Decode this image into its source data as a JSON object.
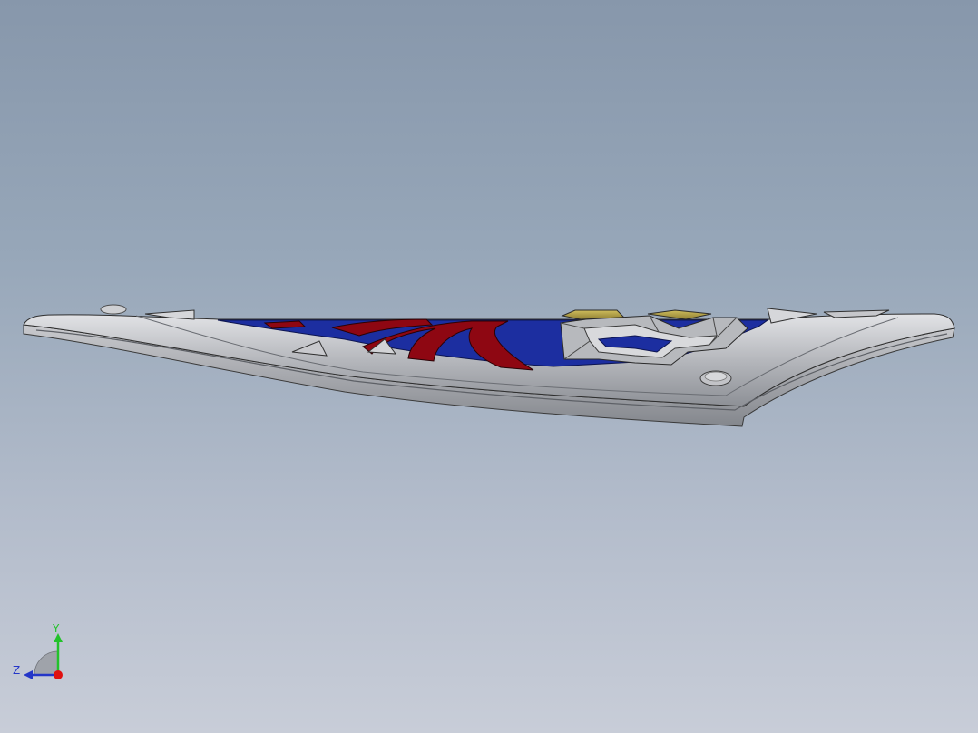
{
  "viewport": {
    "background_top": "#8797ab",
    "background_bottom": "#c8cdd8"
  },
  "model": {
    "part_icon": "shield-part-icon",
    "colors": {
      "steel": "#b7b9bd",
      "steel_dark": "#7c7f86",
      "steel_light": "#dcdde0",
      "blue": "#1c2ea0",
      "red": "#8e0712",
      "gold": "#b6a24a",
      "edge": "#2a2a2a"
    }
  },
  "triad": {
    "y_label": "Y",
    "z_label": "Z",
    "y_color": "#22c22a",
    "z_color": "#2436c8",
    "x_color": "#e01010"
  }
}
